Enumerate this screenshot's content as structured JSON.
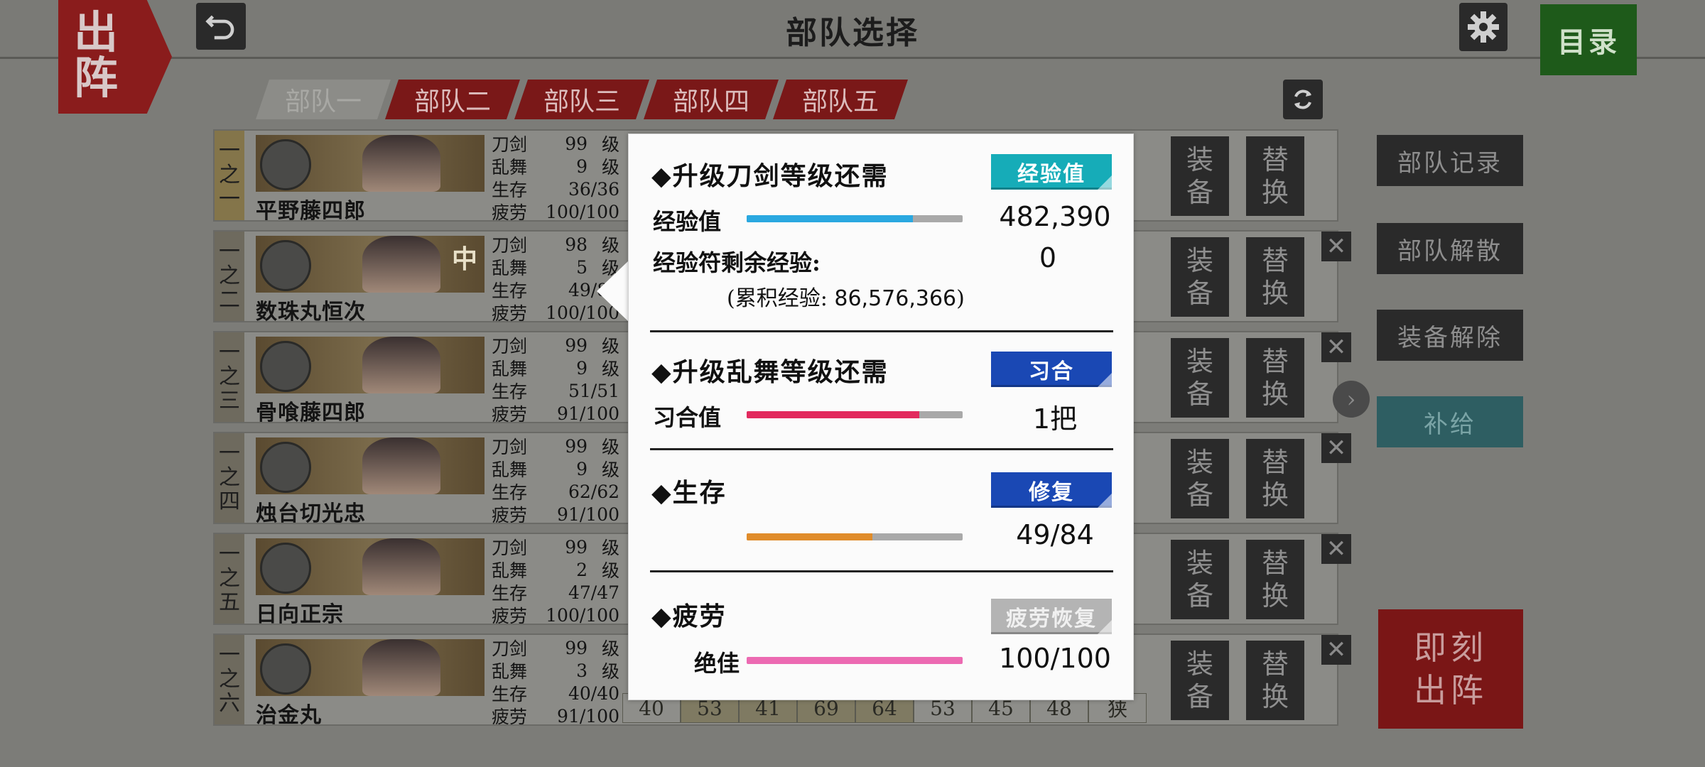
{
  "header": {
    "badge_top": "出",
    "badge_bottom": "阵",
    "title": "部队选择",
    "menu_label": "目录"
  },
  "tabs": [
    {
      "label": "部队一",
      "active": true
    },
    {
      "label": "部队二",
      "active": false
    },
    {
      "label": "部队三",
      "active": false
    },
    {
      "label": "部队四",
      "active": false
    },
    {
      "label": "部队五",
      "active": false
    }
  ],
  "stat_labels": {
    "sword": "刀剑",
    "dance": "乱舞",
    "survival": "生存",
    "fatigue": "疲劳",
    "level_unit": "级"
  },
  "units": [
    {
      "slot": [
        "一",
        "之",
        "一"
      ],
      "name": "平野藤四郎",
      "sword": "99",
      "dance": "9",
      "survival": "36/36",
      "fatigue": "100/100"
    },
    {
      "slot": [
        "一",
        "之",
        "二"
      ],
      "name": "数珠丸恒次",
      "sword": "98",
      "dance": "5",
      "survival": "49/84",
      "fatigue": "100/100",
      "badge": "中"
    },
    {
      "slot": [
        "一",
        "之",
        "三"
      ],
      "name": "骨喰藤四郎",
      "sword": "99",
      "dance": "9",
      "survival": "51/51",
      "fatigue": "91/100"
    },
    {
      "slot": [
        "一",
        "之",
        "四"
      ],
      "name": "烛台切光忠",
      "sword": "99",
      "dance": "9",
      "survival": "62/62",
      "fatigue": "91/100"
    },
    {
      "slot": [
        "一",
        "之",
        "五"
      ],
      "name": "日向正宗",
      "sword": "99",
      "dance": "2",
      "survival": "47/47",
      "fatigue": "100/100"
    },
    {
      "slot": [
        "一",
        "之",
        "六"
      ],
      "name": "治金丸",
      "sword": "99",
      "dance": "3",
      "survival": "40/40",
      "fatigue": "91/100"
    }
  ],
  "row_buttons": {
    "equip": [
      "装",
      "备"
    ],
    "swap": [
      "替",
      "换"
    ],
    "remove": "✕"
  },
  "last_row_cells": [
    "40",
    "53",
    "41",
    "69",
    "64",
    "53",
    "45",
    "48",
    "狭"
  ],
  "side_buttons": {
    "record": "部队记录",
    "dissolve": "部队解散",
    "unequip": "装备解除",
    "supply": "补给",
    "go": [
      "即刻",
      "出阵"
    ]
  },
  "popup": {
    "exp_section": {
      "title": "◆升级刀剑等级还需",
      "button": "经验值",
      "exp_label": "经验值",
      "exp_value": "482,390",
      "exp_fill": 0.77,
      "talisman_label": "经验符剩余经验:",
      "talisman_value": "0",
      "total_note_prefix": "(累积经验:",
      "total_note_value": "86,576,366",
      "total_note_suffix": ")"
    },
    "dance_section": {
      "title": "◆升级乱舞等级还需",
      "button": "习合",
      "label": "习合值",
      "value": "1把",
      "fill": 0.8
    },
    "survival_section": {
      "title": "◆生存",
      "button": "修复",
      "value": "49/84",
      "fill": 0.583
    },
    "fatigue_section": {
      "title": "◆疲劳",
      "button": "疲劳恢复",
      "label": "绝佳",
      "value": "100/100",
      "fill": 1.0
    },
    "colors": {
      "exp_bar": "#2aa8e0",
      "dance_bar": "#e22a5e",
      "survival_bar": "#e08c2a",
      "fatigue_bar": "#ec6ab2"
    }
  }
}
